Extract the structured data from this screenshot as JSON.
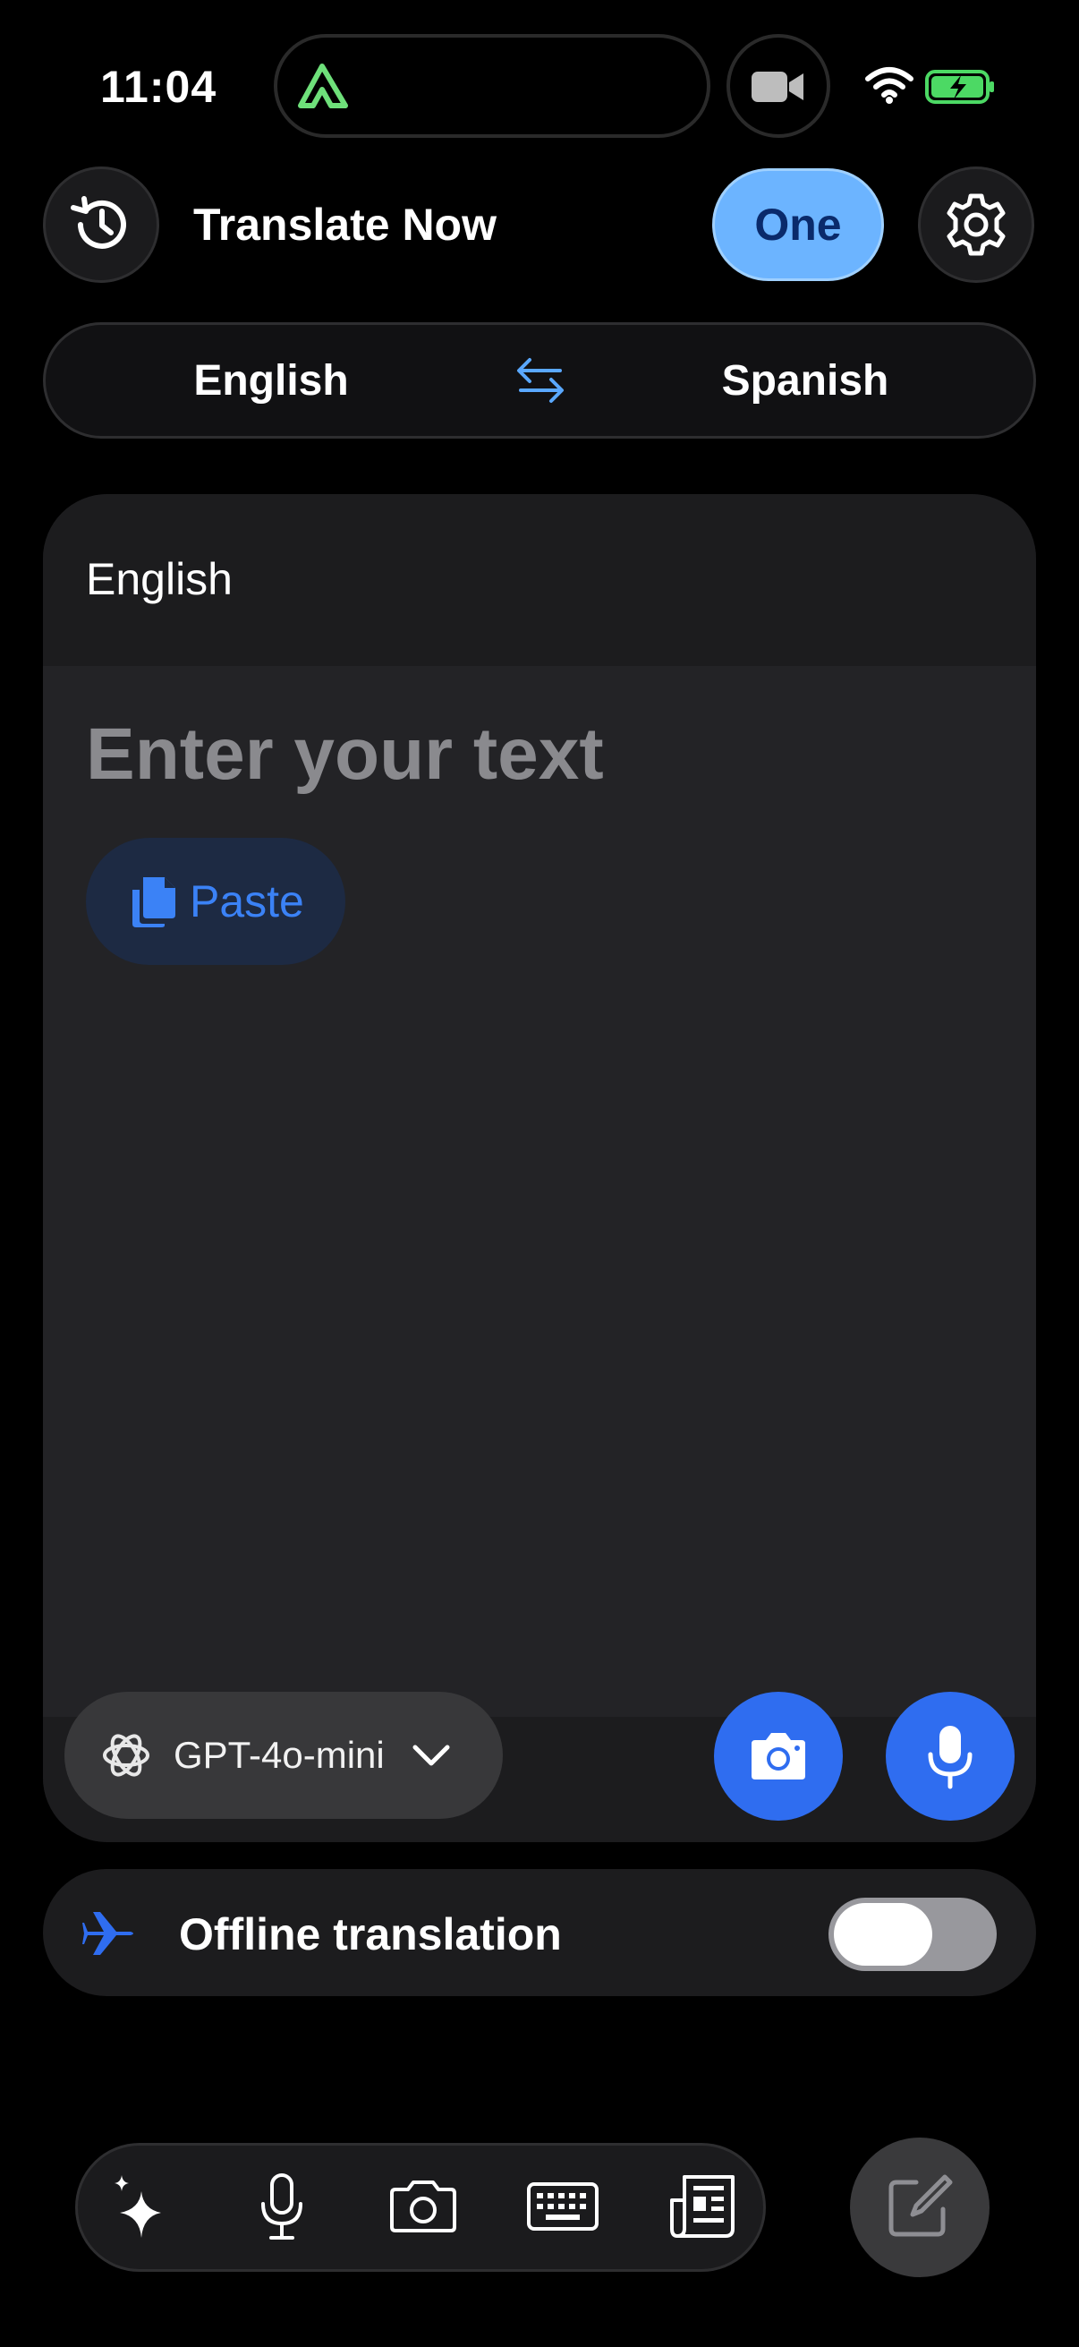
{
  "status_bar": {
    "time": "11:04",
    "icons": [
      "activity-icon",
      "video-camera-icon",
      "wifi-icon",
      "battery-charging-icon"
    ],
    "battery_color": "#4cd964"
  },
  "header": {
    "title": "Translate Now",
    "plan_label": "One",
    "icons": [
      "history-icon",
      "gear-icon"
    ]
  },
  "language_selector": {
    "source": "English",
    "target": "Spanish",
    "swap_icon": "swap-arrows-icon"
  },
  "input_card": {
    "language": "English",
    "placeholder": "Enter your text",
    "paste_label": "Paste",
    "model": "GPT-4o-mini",
    "icons": [
      "clipboard-icon",
      "openai-icon",
      "chevron-down-icon",
      "camera-icon",
      "microphone-icon"
    ]
  },
  "offline": {
    "label": "Offline translation",
    "enabled": false,
    "icon": "airplane-icon"
  },
  "bottom_bar": {
    "tabs": [
      "sparkles-icon",
      "microphone-icon",
      "camera-icon",
      "keyboard-icon",
      "newspaper-icon"
    ],
    "compose_icon": "compose-icon"
  },
  "colors": {
    "background": "#000000",
    "card": "#1c1c1e",
    "accent_blue": "#2f6df0",
    "plan_badge": "#6cb4ff",
    "placeholder": "#8a8a8e"
  }
}
